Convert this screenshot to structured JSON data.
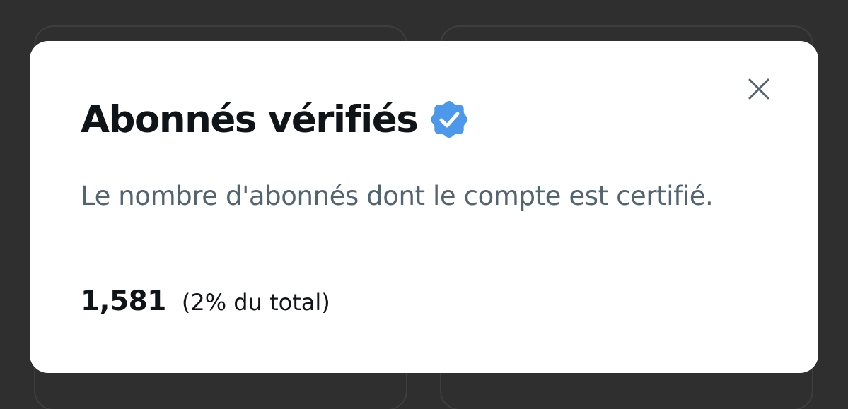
{
  "dialog": {
    "title": "Abonnés vérifiés",
    "verified_icon": "verified-badge-icon",
    "description": "Le nombre d'abonnés dont le compte est certifié.",
    "stat_value": "1,581",
    "stat_share": "(2% du total)",
    "close_icon": "close-icon"
  },
  "colors": {
    "backdrop": "#2f2f2f",
    "modal_bg": "#ffffff",
    "title_text": "#0f1419",
    "secondary_text": "#536471",
    "verified_blue": "#1d9bf0"
  }
}
